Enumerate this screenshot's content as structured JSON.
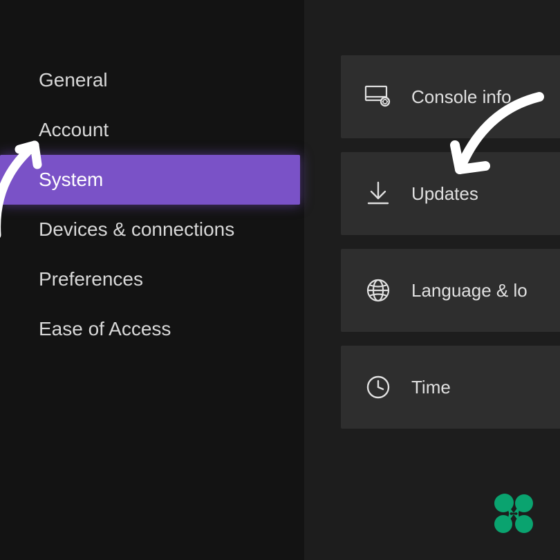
{
  "colors": {
    "accent": "#7a52c7",
    "bg_left": "#131313",
    "bg_right": "#1d1d1d",
    "tile_bg": "#2e2e2e",
    "text": "#d8d8d8",
    "logo": "#0aa36f"
  },
  "sidebar": {
    "items": [
      {
        "label": "General",
        "selected": false
      },
      {
        "label": "Account",
        "selected": false
      },
      {
        "label": "System",
        "selected": true
      },
      {
        "label": "Devices & connections",
        "selected": false
      },
      {
        "label": "Preferences",
        "selected": false
      },
      {
        "label": "Ease of Access",
        "selected": false
      }
    ]
  },
  "tiles": [
    {
      "icon": "console-info-icon",
      "label": "Console info"
    },
    {
      "icon": "download-icon",
      "label": "Updates"
    },
    {
      "icon": "globe-icon",
      "label": "Language & lo"
    },
    {
      "icon": "clock-icon",
      "label": "Time"
    }
  ]
}
